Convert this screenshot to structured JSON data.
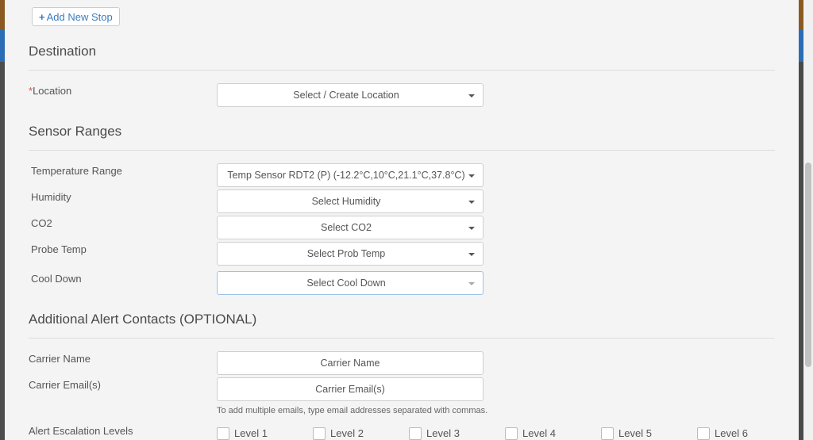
{
  "toolbar": {
    "add_stop_label": "Add New Stop",
    "add_stop_icon": "plus-icon"
  },
  "destination": {
    "title": "Destination",
    "location": {
      "required_mark": "*",
      "label": "Location",
      "value": "Select / Create Location"
    }
  },
  "sensor_ranges": {
    "title": "Sensor Ranges",
    "temperature": {
      "label": "Temperature Range",
      "value": "Temp Sensor RDT2 (P) (-12.2°C,10°C,21.1°C,37.8°C)"
    },
    "humidity": {
      "label": "Humidity",
      "value": "Select Humidity"
    },
    "co2": {
      "label": "CO2",
      "value": "Select CO2"
    },
    "probe_temp": {
      "label": "Probe Temp",
      "value": "Select Prob Temp"
    },
    "cool_down": {
      "label": "Cool Down",
      "value": "Select Cool Down"
    }
  },
  "alert_contacts": {
    "title": "Additional Alert Contacts (OPTIONAL)",
    "carrier_name": {
      "label": "Carrier Name",
      "placeholder": "Carrier Name"
    },
    "carrier_email": {
      "label": "Carrier Email(s)",
      "placeholder": "Carrier Email(s)"
    },
    "help_text": "To add multiple emails, type email addresses separated with commas.",
    "escalation_label": "Alert Escalation Levels",
    "levels": [
      {
        "label": "Level 1",
        "checked": false
      },
      {
        "label": "Level 2",
        "checked": false
      },
      {
        "label": "Level 3",
        "checked": false
      },
      {
        "label": "Level 4",
        "checked": false
      },
      {
        "label": "Level 5",
        "checked": false
      },
      {
        "label": "Level 6",
        "checked": false
      }
    ]
  }
}
